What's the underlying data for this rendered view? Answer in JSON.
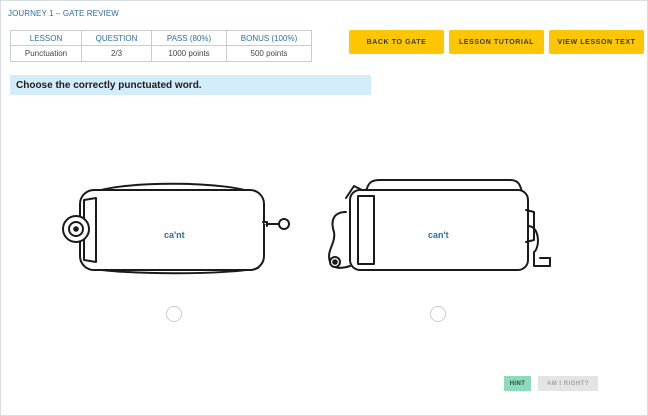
{
  "header": {
    "journey_title": "JOURNEY 1 – GATE REVIEW"
  },
  "info_table": {
    "headers": [
      "LESSON",
      "QUESTION",
      "PASS (80%)",
      "BONUS (100%)"
    ],
    "values": [
      "Punctuation",
      "2/3",
      "1000 points",
      "500 points"
    ]
  },
  "buttons": {
    "back_to_gate": "BACK TO GATE",
    "lesson_tutorial": "LESSON TUTORIAL",
    "view_lesson_text": "VIEW LESSON TEXT",
    "hint": "HINT",
    "am_i_right": "AM I RIGHT?"
  },
  "question": {
    "prompt": "Choose the correctly punctuated word.",
    "choices": [
      "ca'nt",
      "can't"
    ]
  },
  "colors": {
    "accent_yellow": "#fdc600",
    "link_blue": "#2e6da4",
    "prompt_bg": "#d3ecfa",
    "hint_green": "#8fd9bd"
  },
  "icons": [
    "toaster-left-icon",
    "toaster-right-icon"
  ]
}
